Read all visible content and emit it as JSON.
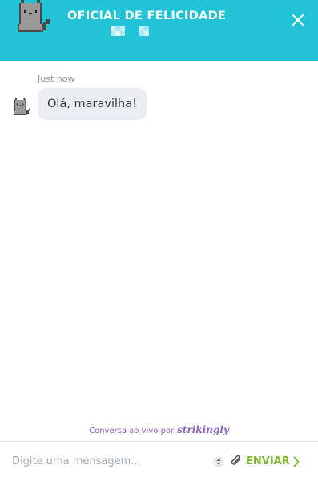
{
  "header": {
    "title": "OFICIAL DE FELICIDADE",
    "avatar_icon": "pixel-cat-icon",
    "close_icon": "close-icon",
    "background": "#21c4d6"
  },
  "messages": [
    {
      "timestamp": "Just now",
      "text": "Olá, maravilha!",
      "sender_avatar_icon": "pixel-cat-icon"
    }
  ],
  "footer": {
    "powered_prefix": "Conversa ao vivo por",
    "powered_brand": "strikingly"
  },
  "composer": {
    "placeholder": "Digite uma mensagem...",
    "send_label": "ENVIAR",
    "send_color": "#7cb82f",
    "emoji_icon": "emoji-icon",
    "attach_icon": "paperclip-icon"
  }
}
